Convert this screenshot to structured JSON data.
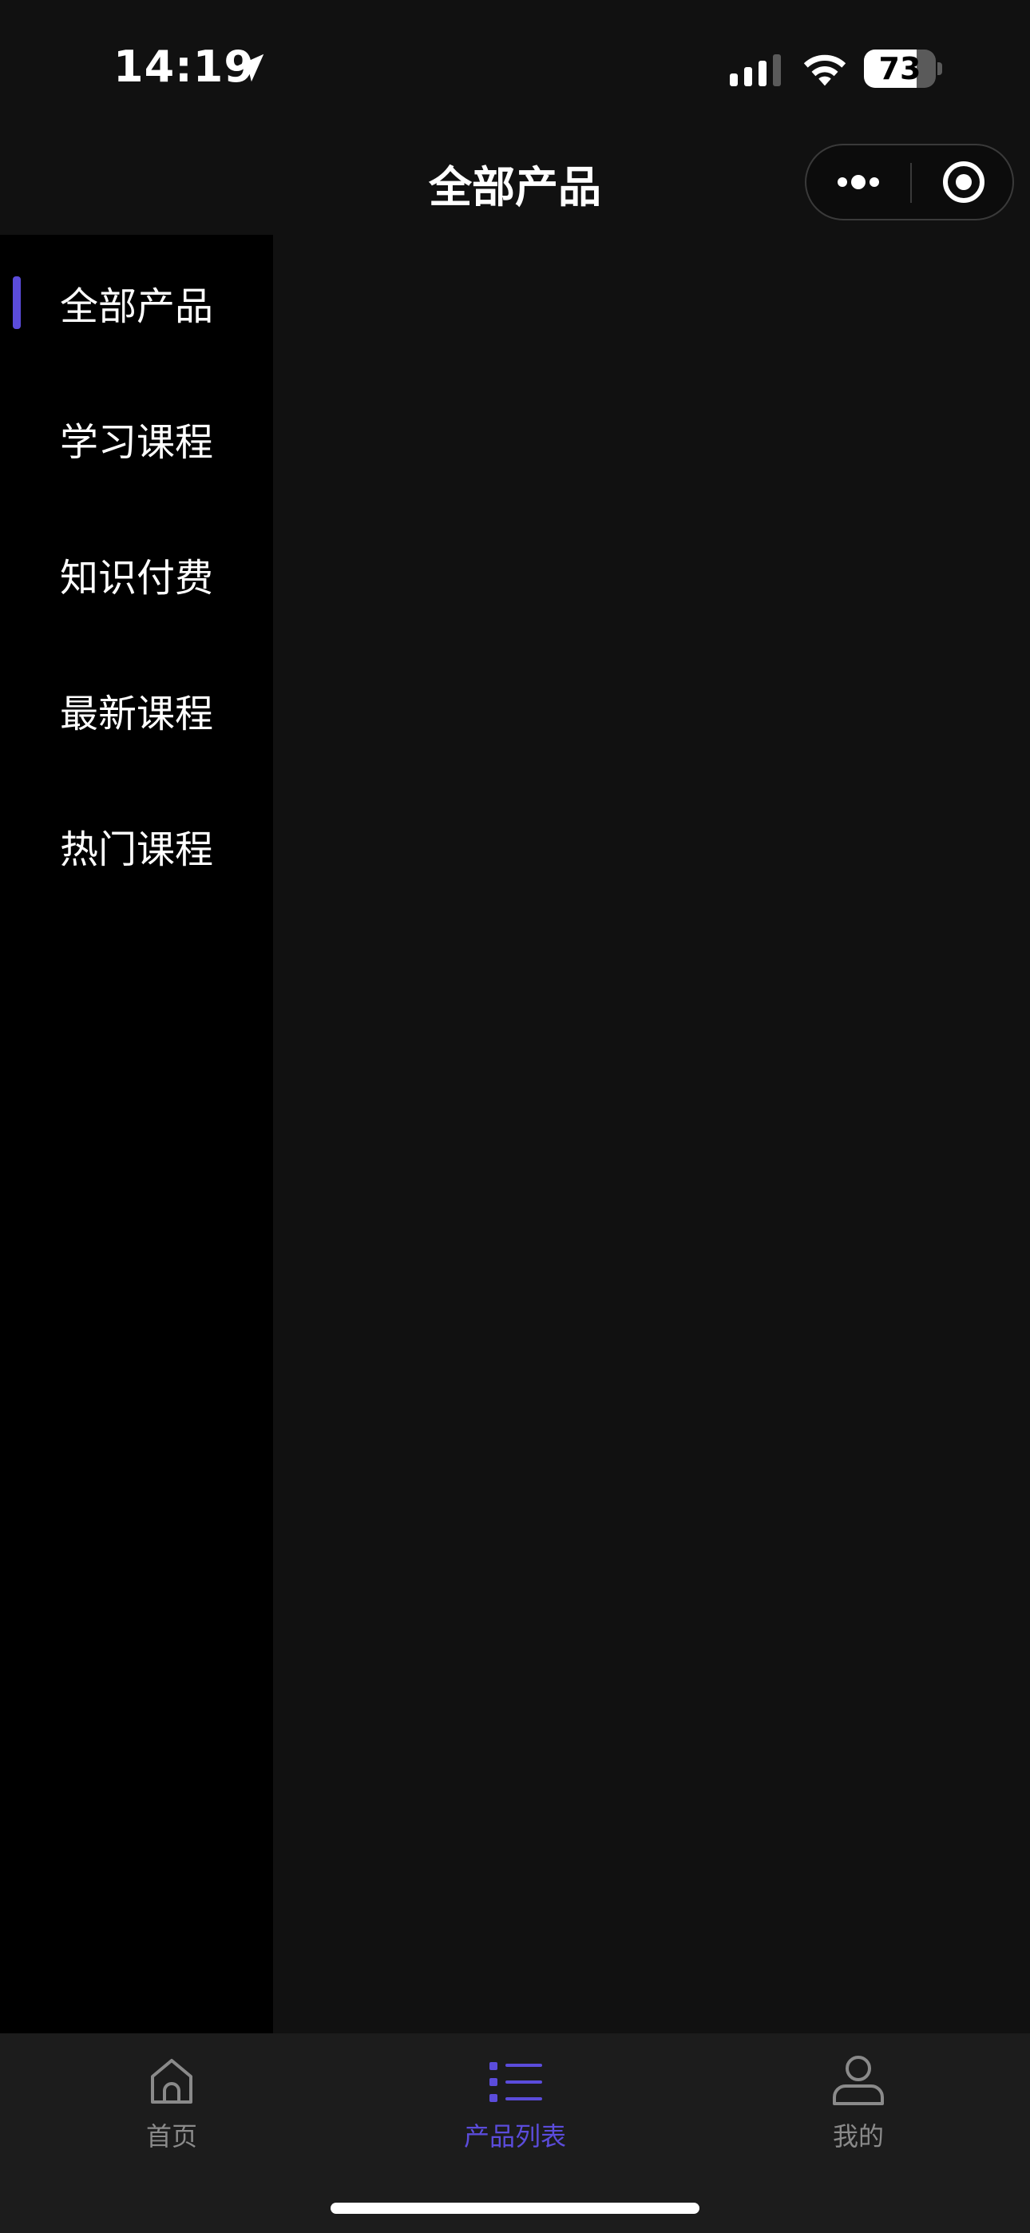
{
  "status_bar": {
    "time": "14:19",
    "battery_level": "73",
    "battery_fraction": 0.73,
    "icons": [
      "location-arrow-icon",
      "cellular-signal-icon",
      "wifi-icon",
      "battery-icon"
    ]
  },
  "nav": {
    "title": "全部产品",
    "capsule_icons": [
      "more-dots-icon",
      "close-target-icon"
    ]
  },
  "sidebar": {
    "active_index": 0,
    "items": [
      {
        "label": "全部产品"
      },
      {
        "label": "学习课程"
      },
      {
        "label": "知识付费"
      },
      {
        "label": "最新课程"
      },
      {
        "label": "热门课程"
      }
    ]
  },
  "tabbar": {
    "active_index": 1,
    "tabs": [
      {
        "label": "首页",
        "icon": "home-icon"
      },
      {
        "label": "产品列表",
        "icon": "list-icon"
      },
      {
        "label": "我的",
        "icon": "user-icon"
      }
    ]
  },
  "colors": {
    "accent": "#5b4cdb",
    "background": "#111111",
    "sidebar_background": "#000000",
    "tabbar_background": "#1c1c1c",
    "inactive_text": "#8a8a8a"
  }
}
